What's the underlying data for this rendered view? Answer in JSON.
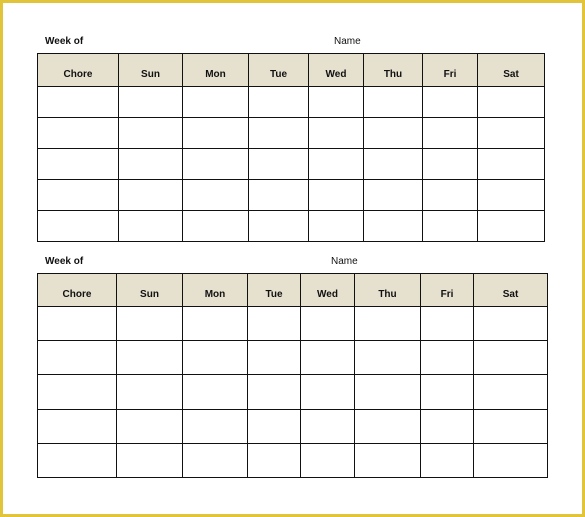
{
  "sheets": [
    {
      "week_label": "Week of",
      "name_label": "Name",
      "columns": [
        "Chore",
        "Sun",
        "Mon",
        "Tue",
        "Wed",
        "Thu",
        "Fri",
        "Sat"
      ],
      "row_count": 5
    },
    {
      "week_label": "Week of",
      "name_label": "Name",
      "columns": [
        "Chore",
        "Sun",
        "Mon",
        "Tue",
        "Wed",
        "Thu",
        "Fri",
        "Sat"
      ],
      "row_count": 5
    }
  ],
  "colors": {
    "border": "#e2c43a",
    "header_fill": "#e6e0cf"
  }
}
